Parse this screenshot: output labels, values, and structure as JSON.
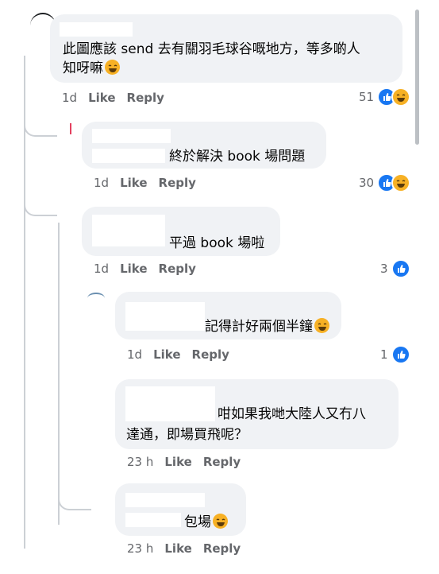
{
  "comments": [
    {
      "line1": "此圖應該 send 去有關羽毛球谷嘅地方，等多啲人",
      "line2": "知呀嘛",
      "time": "1d",
      "like": "Like",
      "reply": "Reply",
      "count": "51",
      "reactions": [
        "like-icon",
        "haha-icon"
      ]
    },
    {
      "line1": "終於解決 book 場問題",
      "time": "1d",
      "like": "Like",
      "reply": "Reply",
      "count": "30",
      "reactions": [
        "like-icon",
        "haha-icon"
      ]
    },
    {
      "line1": "平過 book 場啦",
      "time": "1d",
      "like": "Like",
      "reply": "Reply",
      "count": "3",
      "reactions": [
        "like-icon"
      ]
    },
    {
      "line1": "記得計好兩個半鐘",
      "time": "1d",
      "like": "Like",
      "reply": "Reply",
      "count": "1",
      "reactions": [
        "like-icon"
      ]
    },
    {
      "line1": "咁如果我哋大陸人又冇八",
      "line2": "達通，即場買飛呢？",
      "time": "23 h",
      "like": "Like",
      "reply": "Reply"
    },
    {
      "line1": "包場",
      "time": "23 h",
      "like": "Like",
      "reply": "Reply"
    }
  ],
  "colors": {
    "bubble": "#f0f2f5",
    "like": "#1877f2",
    "haha": "#f7b125",
    "meta": "#65676b"
  }
}
